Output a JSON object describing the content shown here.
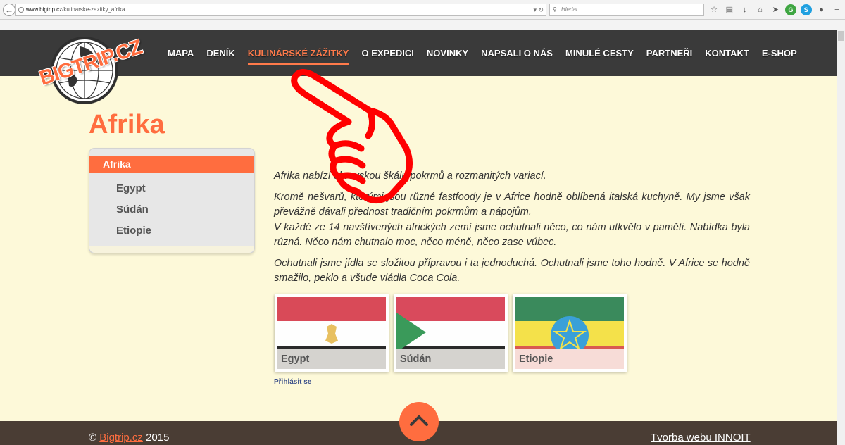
{
  "browser": {
    "url_host": "www.bigtrip.cz",
    "url_path": "/kulinarske-zazitky_afrika",
    "search_placeholder": "Hledat"
  },
  "logo": {
    "text": "BIGTRIP.CZ"
  },
  "nav": {
    "items": [
      {
        "label": "MAPA",
        "active": false
      },
      {
        "label": "DENÍK",
        "active": false
      },
      {
        "label": "KULINÁRSKÉ ZÁŽITKY",
        "active": true
      },
      {
        "label": "O EXPEDICI",
        "active": false
      },
      {
        "label": "NOVINKY",
        "active": false
      },
      {
        "label": "NAPSALI O NÁS",
        "active": false
      },
      {
        "label": "MINULÉ CESTY",
        "active": false
      },
      {
        "label": "PARTNEŘI",
        "active": false
      },
      {
        "label": "KONTAKT",
        "active": false
      },
      {
        "label": "E-SHOP",
        "active": false
      }
    ]
  },
  "page": {
    "title": "Afrika"
  },
  "sidebar": {
    "heading": "Afrika",
    "items": [
      "Egypt",
      "Súdán",
      "Etiopie"
    ]
  },
  "content": {
    "paragraphs": [
      "Afrika nabízí obrovskou škálu pokrmů a rozmanitých variací.",
      "Kromě nešvarů, kterými jsou různé fastfoody je v Africe hodně oblíbená italská kuchyně. My jsme však převážně dávali přednost tradičním pokrmům a nápojům.",
      "V každé ze 14 navštívených afrických zemí jsme ochutnali něco, co nám utkvělo v paměti. Nabídka byla různá. Něco nám chutnalo moc, něco méně, něco zase vůbec.",
      "Ochutnali jsme jídla se složitou přípravou i ta jednoduchá. Ochutnali jsme toho hodně. V Africe se hodně smažilo, peklo a všude vládla Coca Cola."
    ]
  },
  "flags": [
    {
      "label": "Egypt"
    },
    {
      "label": "Súdán"
    },
    {
      "label": "Etiopie"
    }
  ],
  "login": {
    "label": "Přihlásit se"
  },
  "footer": {
    "copyright_symbol": "©",
    "site_link": "Bigtrip.cz",
    "year": "2015",
    "credit_link": "Tvorba webu INNOIT"
  },
  "colors": {
    "accent": "#ff6d3f",
    "header_bg": "#3a3a3a",
    "page_bg": "#fdf9d9",
    "footer_bg": "#4a3d34"
  }
}
